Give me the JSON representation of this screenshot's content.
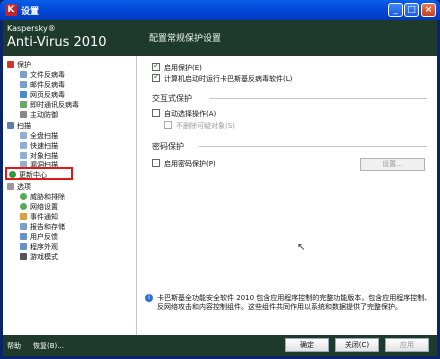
{
  "window": {
    "title": "设置"
  },
  "header": {
    "brand_top": "Kaspersky®",
    "brand_name": "Anti-Virus 2010",
    "page_title": "配置常规保护设置"
  },
  "sidebar": {
    "items": [
      {
        "label": "保护",
        "level": 0
      },
      {
        "label": "文件反病毒",
        "level": 1
      },
      {
        "label": "邮件反病毒",
        "level": 1
      },
      {
        "label": "网页反病毒",
        "level": 1
      },
      {
        "label": "即时通讯反病毒",
        "level": 1
      },
      {
        "label": "主动防御",
        "level": 1
      },
      {
        "label": "扫描",
        "level": 0
      },
      {
        "label": "全盘扫描",
        "level": 1
      },
      {
        "label": "快速扫描",
        "level": 1
      },
      {
        "label": "对象扫描",
        "level": 1
      },
      {
        "label": "漏洞扫描",
        "level": 1
      },
      {
        "label": "更新中心",
        "level": 0
      },
      {
        "label": "选项",
        "level": 0
      },
      {
        "label": "威胁和排除",
        "level": 1
      },
      {
        "label": "网络设置",
        "level": 1
      },
      {
        "label": "事件通知",
        "level": 1
      },
      {
        "label": "报告和存储",
        "level": 1
      },
      {
        "label": "用户反馈",
        "level": 1
      },
      {
        "label": "程序外观",
        "level": 1
      },
      {
        "label": "游戏模式",
        "level": 1
      }
    ]
  },
  "main": {
    "options": [
      {
        "label": "启用保护(E)",
        "checked": true
      },
      {
        "label": "计算机启动时运行卡巴斯基反病毒软件(L)",
        "checked": true
      }
    ],
    "interactive": {
      "title": "交互式保护",
      "auto_action": "自动选择操作(A)",
      "no_delete": "不删除可疑对象(S)"
    },
    "password": {
      "title": "密码保护",
      "enable": "启用密码保护(P)",
      "settings_button": "设置..."
    },
    "info_text": "卡巴斯基全功能安全软件 2010 包含应用程序控制的完整功能版本，包含应用程序控制、反网络攻击和内容控制组件。这些组件共同作用以系统和数据提供了完整保护。"
  },
  "footer": {
    "help": "帮助",
    "restore": "恢复(B)...",
    "ok": "确定",
    "close": "关闭(C)",
    "apply": "应用"
  },
  "colors": {
    "header_bg": "#1e3a2c",
    "titlebar": "#0044d6",
    "highlight": "#e21818"
  }
}
